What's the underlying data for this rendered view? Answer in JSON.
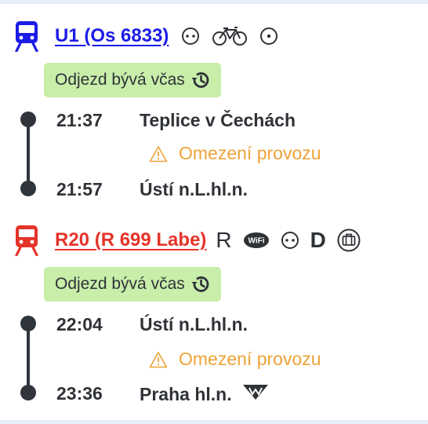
{
  "trains": [
    {
      "name": "U1 (Os 6833)",
      "color": "#1c1ce6",
      "icons": [
        "seat-reservation-icon",
        "bicycle-icon",
        "stop-on-request-icon"
      ],
      "badge": "Odjezd bývá včas",
      "stops": [
        {
          "time": "21:37",
          "station": "Teplice v Čechách"
        },
        {
          "time": "21:57",
          "station": "Ústí n.L.hl.n."
        }
      ],
      "notice": "Omezení provozu"
    },
    {
      "name": "R20 (R 699 Labe)",
      "color": "#e5342a",
      "icons": [
        "R",
        "wifi-icon",
        "seat-reservation-icon",
        "D",
        "luggage-icon"
      ],
      "badge": "Odjezd bývá včas",
      "stops": [
        {
          "time": "22:04",
          "station": "Ústí n.L.hl.n."
        },
        {
          "time": "23:36",
          "station": "Praha hl.n."
        }
      ],
      "notice": "Omezení provozu",
      "station_icon": "metro-icon"
    }
  ]
}
